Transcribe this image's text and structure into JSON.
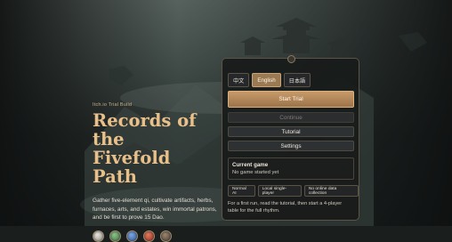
{
  "hero": {
    "eyebrow": "Itch.io Trial Build",
    "title_line1": "Records of the",
    "title_line2": "Fivefold Path",
    "description": "Gather five-element qi, cultivate artifacts, herbs, furnaces, arts, and estates, win immortal patrons, and be first to prove 15 Dao.",
    "elements": [
      {
        "icon": "metal-element-icon",
        "color": "#b9b8b2"
      },
      {
        "icon": "wood-element-icon",
        "color": "#4f8f52"
      },
      {
        "icon": "water-element-icon",
        "color": "#3f6fb5"
      },
      {
        "icon": "fire-element-icon",
        "color": "#b5412f"
      },
      {
        "icon": "earth-element-icon",
        "color": "#6a5a48"
      }
    ]
  },
  "panel": {
    "languages": [
      {
        "label": "中文",
        "active": false
      },
      {
        "label": "English",
        "active": true
      },
      {
        "label": "日本語",
        "active": false
      }
    ],
    "start_label": "Start Trial",
    "continue_label": "Continue",
    "tutorial_label": "Tutorial",
    "settings_label": "Settings",
    "current_game_title": "Current game",
    "current_game_status": "No game started yet",
    "tags": [
      "Normal AI",
      "Local single-player",
      "No online data collection"
    ],
    "hint": "For a first run, read the tutorial, then start a 4-player table for the full rhythm."
  },
  "colors": {
    "accent": "#c79a6a",
    "title": "#e9c08a",
    "panel_bg": "#181b1a"
  }
}
